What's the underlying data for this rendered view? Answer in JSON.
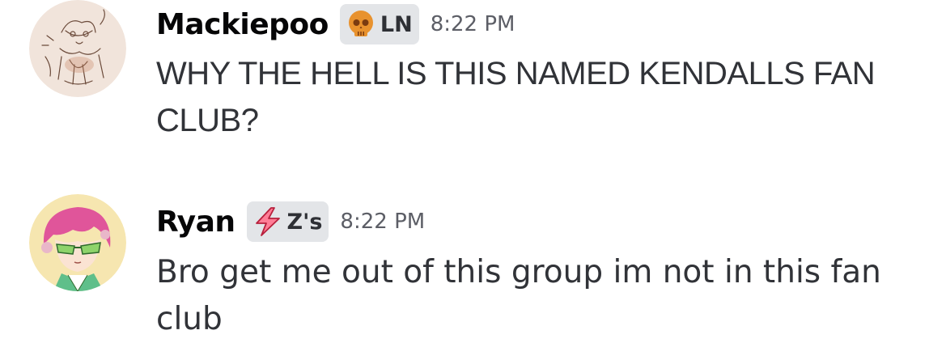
{
  "messages": [
    {
      "username": "Mackiepoo",
      "role_tag": {
        "icon": "skull-icon",
        "label": "LN",
        "icon_color": "#e8922e"
      },
      "timestamp": "8:22 PM",
      "text": "WHY THE HELL IS THIS NAMED KENDALLS FAN CLUB?"
    },
    {
      "username": "Ryan",
      "role_tag": {
        "icon": "lightning-icon",
        "label": "Z's",
        "icon_color": "#e0405c"
      },
      "timestamp": "8:22 PM",
      "text": "Bro get me out of this group im not in this fan club"
    }
  ],
  "colors": {
    "background": "#ffffff",
    "username": "#060607",
    "message_text": "#313338",
    "timestamp": "#5c5e66",
    "role_tag_bg": "#e3e5e8"
  }
}
